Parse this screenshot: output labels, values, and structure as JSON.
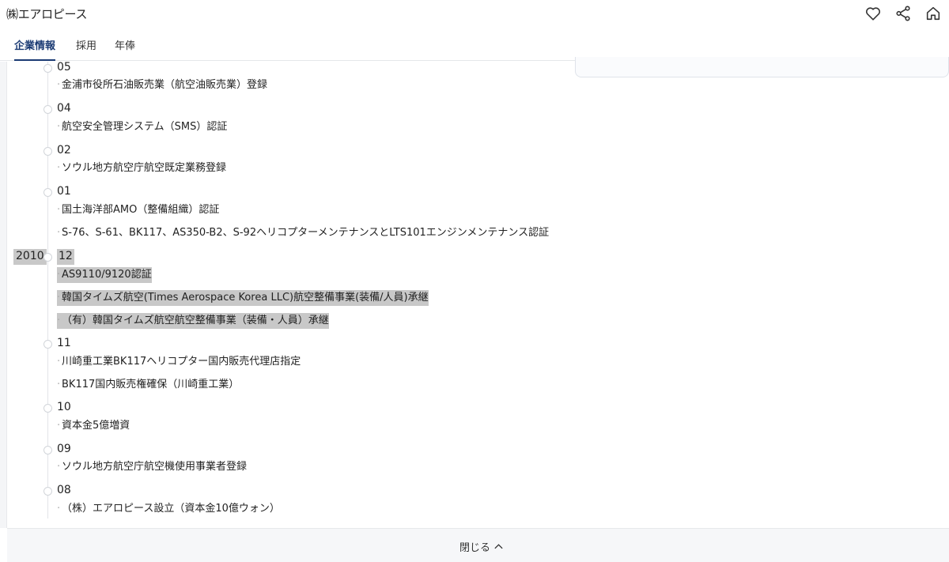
{
  "header": {
    "company_name": "㈱エアロピース",
    "icons": [
      "heart-icon",
      "share-icon",
      "home-icon"
    ]
  },
  "tabs": [
    {
      "label": "企業情報",
      "active": true
    },
    {
      "label": "採用",
      "active": false
    },
    {
      "label": "年俸",
      "active": false
    }
  ],
  "timeline": {
    "year_2010": "2010",
    "m05": "05",
    "m05_e1": "金浦市役所石油販売業（航空油販売業）登録",
    "m04": "04",
    "m04_e1": "航空安全管理システム（SMS）認証",
    "m02": "02",
    "m02_e1": "ソウル地方航空庁航空既定業務登録",
    "m01": "01",
    "m01_e1": "国土海洋部AMO（整備組織）認証",
    "m01_e2": "S-76、S-61、BK117、AS350-B2、S-92ヘリコプターメンテナンスとLTS101エンジンメンテナンス認証",
    "m12": "12",
    "m12_e1": "AS9110/9120認証",
    "m12_e2": "韓国タイムズ航空(Times Aerospace Korea LLC)航空整備事業(装備/人員)承継",
    "m12_e3": "（有）韓国タイムズ航空航空整備事業（装備・人員）承継",
    "m11": "11",
    "m11_e1": "川崎重工業BK117ヘリコプター国内販売代理店指定",
    "m11_e2": "BK117国内販売権確保（川崎重工業）",
    "m10": "10",
    "m10_e1": "資本金5億増資",
    "m09": "09",
    "m09_e1": "ソウル地方航空庁航空機使用事業者登録",
    "m08": "08",
    "m08_e1": "（株）エアロピース設立（資本金10億ウォン）"
  },
  "footer": {
    "close_label": "閉じる"
  }
}
